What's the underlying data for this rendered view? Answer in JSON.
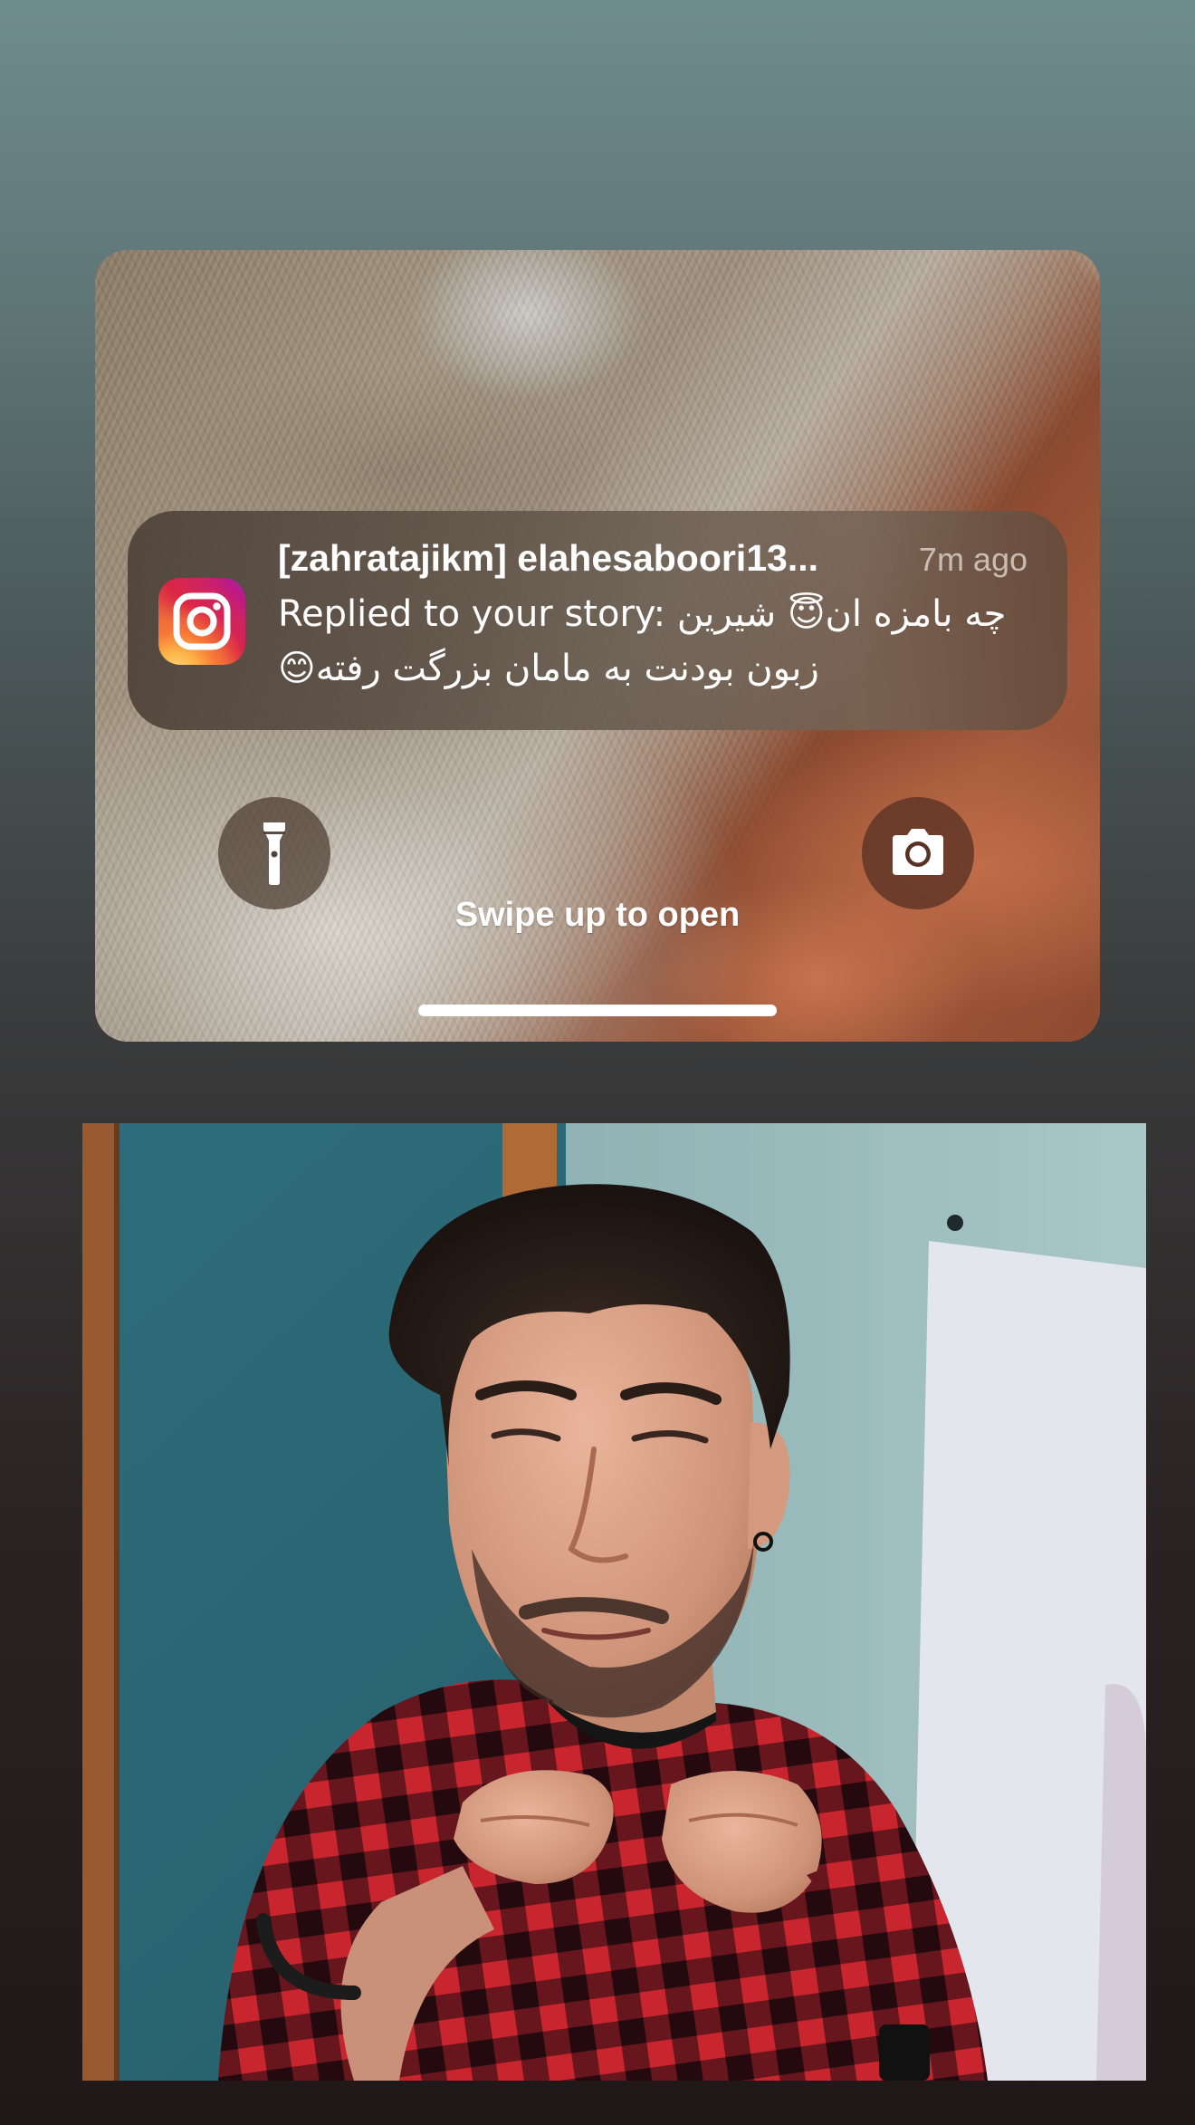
{
  "notification": {
    "app_icon": "instagram-icon",
    "title": "[zahratajikm] elahesaboori13...",
    "time": "7m ago",
    "body_line1": "Replied to your story: چه بامزه ان😇 شیرین",
    "body_line2": "زبون بودنت به مامان بزرگت رفته😊"
  },
  "lock_screen": {
    "flashlight_icon": "flashlight-icon",
    "camera_icon": "camera-icon",
    "swipe_text": "Swipe up to open"
  },
  "colors": {
    "instagram_gradient": [
      "#f09433",
      "#dc2743",
      "#bc1888",
      "#8a3ab9"
    ],
    "shirt_red": "#c6222b",
    "wall_teal": "#2f6f7d"
  }
}
